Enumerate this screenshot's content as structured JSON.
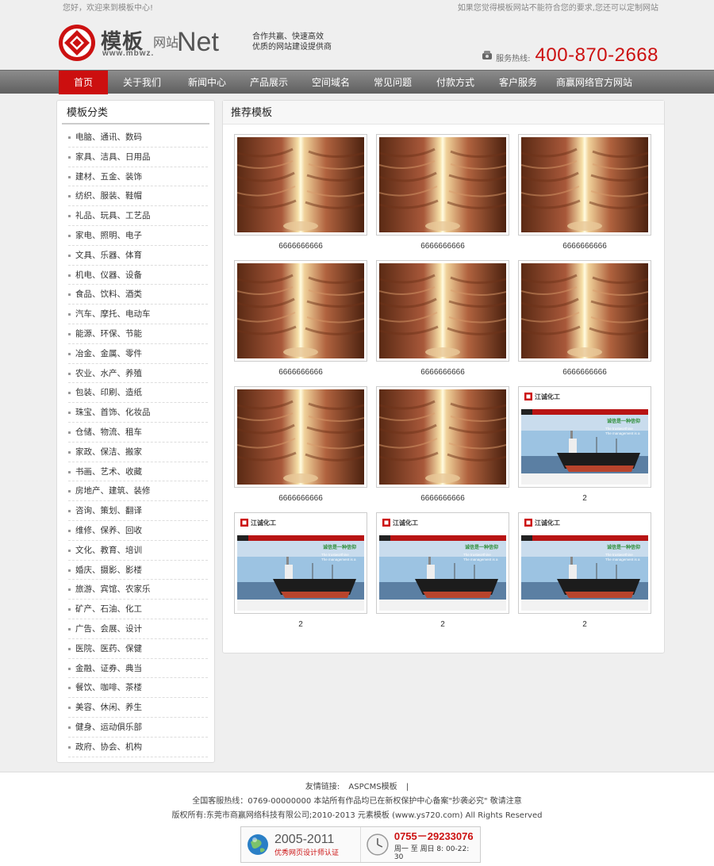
{
  "topbar": {
    "welcome": "您好，欢迎来到模板中心!",
    "notice": "如果您觉得模板网站不能符合您的要求,您还可以定制网站"
  },
  "logo": {
    "cn": "模板",
    "cn_small": "网站",
    "net": "Net",
    "url": "www.mbwz.",
    "brand_color": "#cc1111"
  },
  "slogan": {
    "line1": "合作共赢、快速高效",
    "line2": "优质的网站建设提供商"
  },
  "hotline": {
    "label": "服务热线:",
    "number": "400-870-2668"
  },
  "nav": {
    "items": [
      {
        "label": "首页"
      },
      {
        "label": "关于我们"
      },
      {
        "label": "新闻中心"
      },
      {
        "label": "产品展示"
      },
      {
        "label": "空间域名"
      },
      {
        "label": "常见问题"
      },
      {
        "label": "付款方式"
      },
      {
        "label": "客户服务"
      },
      {
        "label": "商赢网络官方网站"
      }
    ]
  },
  "sidebar": {
    "title": "模板分类",
    "items": [
      "电脑、通讯、数码",
      "家具、洁具、日用品",
      "建材、五金、装饰",
      "纺织、服装、鞋帽",
      "礼品、玩具、工艺品",
      "家电、照明、电子",
      "文具、乐器、体育",
      "机电、仪器、设备",
      "食品、饮料、酒类",
      "汽车、摩托、电动车",
      "能源、环保、节能",
      "冶金、金属、零件",
      "农业、水产、养殖",
      "包装、印刷、造纸",
      "珠宝、首饰、化妆品",
      "仓储、物流、租车",
      "家政、保洁、搬家",
      "书画、艺术、收藏",
      "房地产、建筑、装修",
      "咨询、策划、翻译",
      "维修、保养、回收",
      "文化、教育、培训",
      "婚庆、摄影、影楼",
      "旅游、宾馆、农家乐",
      "矿产、石油、化工",
      "广告、会展、设计",
      "医院、医药、保健",
      "金融、证券、典当",
      "餐饮、咖啡、茶楼",
      "美容、休闲、养生",
      "健身、运动俱乐部",
      "政府、协会、机构"
    ]
  },
  "main": {
    "title": "推荐模板",
    "products": [
      {
        "caption": "6666666666",
        "image": "canyon"
      },
      {
        "caption": "6666666666",
        "image": "canyon"
      },
      {
        "caption": "6666666666",
        "image": "canyon"
      },
      {
        "caption": "6666666666",
        "image": "canyon"
      },
      {
        "caption": "6666666666",
        "image": "canyon"
      },
      {
        "caption": "6666666666",
        "image": "canyon"
      },
      {
        "caption": "6666666666",
        "image": "canyon"
      },
      {
        "caption": "6666666666",
        "image": "canyon"
      },
      {
        "caption": "2",
        "image": "ship-site"
      },
      {
        "caption": "2",
        "image": "ship-site"
      },
      {
        "caption": "2",
        "image": "ship-site"
      },
      {
        "caption": "2",
        "image": "ship-site"
      }
    ],
    "ship_site": {
      "brand": "江诚化工",
      "headline": "诚信是一种信仰",
      "sub1": "The trustworthine",
      "sub2": "The management is a"
    }
  },
  "footer": {
    "links_label": "友情链接:",
    "link1": "ASPCMS模板",
    "separator": "|",
    "line2": "全国客服热线：0769-00000000 本站所有作品均已在新权保护中心备案\"抄袭必究\" 敬请注意",
    "line3": "版权所有:东莞市商赢网络科技有限公司;2010-2013  元素模板 (www.ys720.com) All Rights Reserved",
    "badge1_years": "2005-2011",
    "badge1_text": "优秀网页设计师认证",
    "badge2_phone": "0755－29233076",
    "badge2_hours": "周一 至 周日 8: 00-22: 30"
  }
}
